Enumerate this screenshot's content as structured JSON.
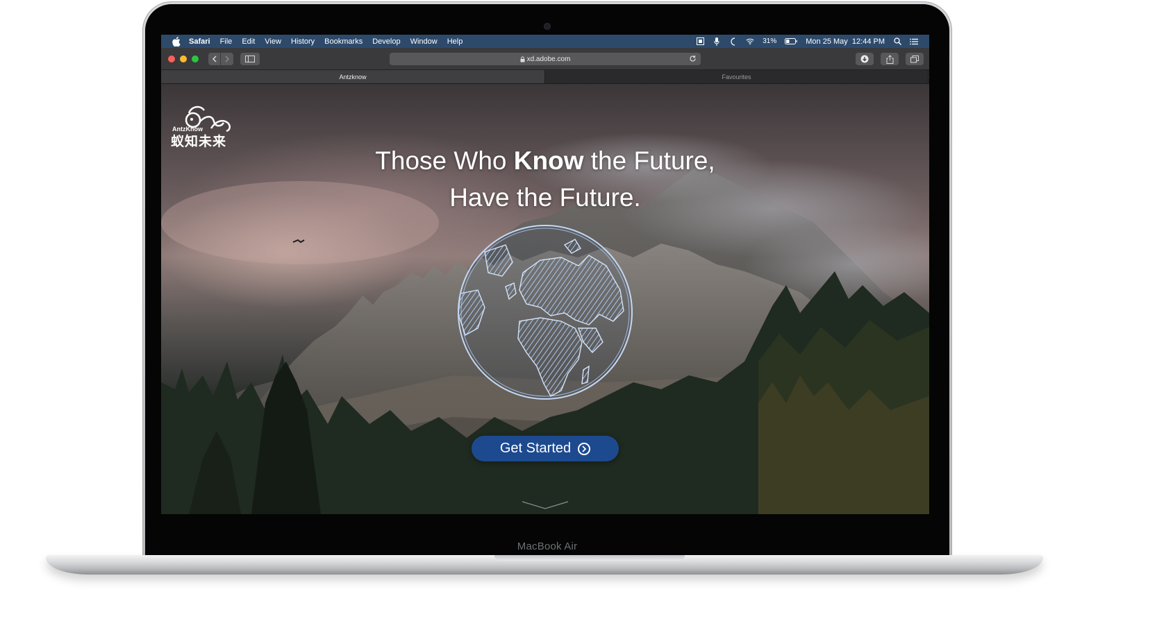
{
  "menubar": {
    "items": [
      "Safari",
      "File",
      "Edit",
      "View",
      "History",
      "Bookmarks",
      "Develop",
      "Window",
      "Help"
    ],
    "battery": "31%",
    "datetime": "Mon 25 May  12:44 PM"
  },
  "toolbar": {
    "address": "xd.adobe.com"
  },
  "tabs": [
    {
      "label": "Antzknow",
      "active": true
    },
    {
      "label": "Favourites",
      "active": false
    }
  ],
  "tab_add": "+",
  "page": {
    "logo_en": "AntzKnow",
    "logo_cn": "蚁知未来",
    "headline_line1_pre": "Those Who ",
    "headline_line1_bold": "Know",
    "headline_line1_post": " the Future,",
    "headline_line2": "Have the Future.",
    "cta_label": "Get Started"
  },
  "device": {
    "label": "MacBook Air"
  },
  "colors": {
    "menubar": "#2d4a6b",
    "cta": "#1d4a8f",
    "traffic_red": "#ff5f57",
    "traffic_yellow": "#febc2e",
    "traffic_green": "#28c840"
  },
  "icons": [
    "apple-icon",
    "screen-mirroring-icon",
    "microphone-icon",
    "do-not-disturb-icon",
    "wifi-icon",
    "battery-icon",
    "spotlight-search-icon",
    "control-center-icon",
    "back-icon",
    "forward-icon",
    "sidebar-icon",
    "lock-icon",
    "reload-icon",
    "download-icon",
    "share-icon",
    "tabs-overview-icon",
    "globe-illustration",
    "chevron-right-circle-icon",
    "chevron-down-icon"
  ]
}
